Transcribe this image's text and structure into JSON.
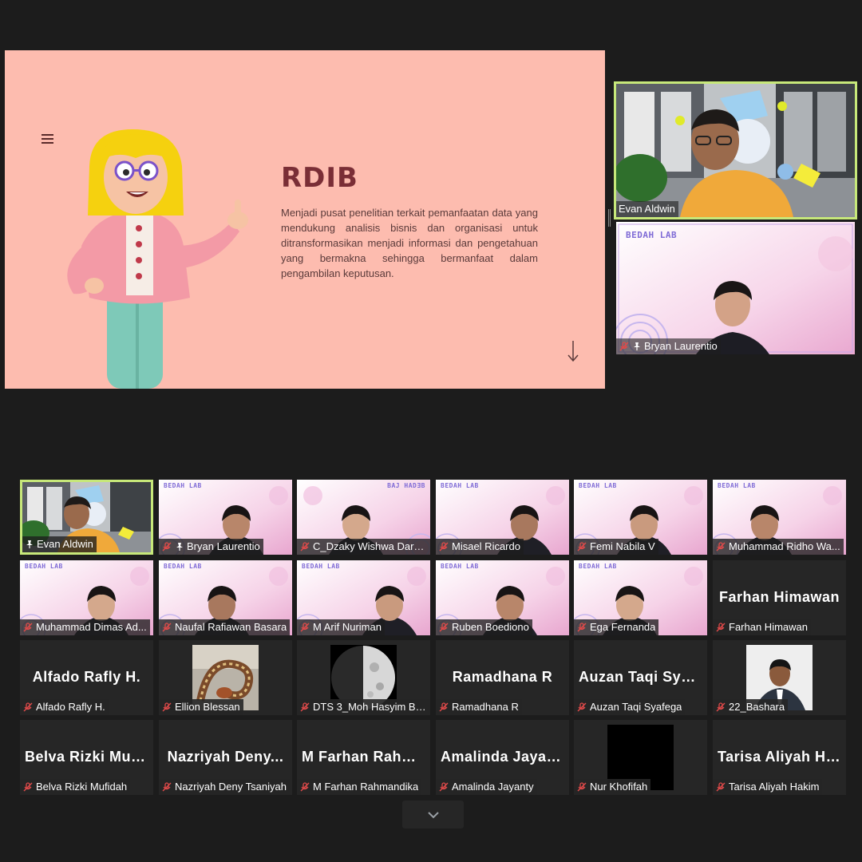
{
  "slide": {
    "title": "RDIB",
    "body": "Menjadi pusat penelitian terkait pemanfaatan data yang mendukung analisis bisnis dan organisasi untuk ditransformasikan menjadi informasi dan pengetahuan yang bermakna sehingga bermanfaat dalam pengambilan keputusan.",
    "menu_icon": "hamburger-icon",
    "arrow_icon": "arrow-down-icon",
    "colors": {
      "background": "#fdbcaf",
      "title": "#7a2e36"
    }
  },
  "pinned": {
    "speaker": {
      "name": "Evan Aldwin"
    },
    "second": {
      "name": "Bryan Laurentio",
      "brand": "BEDAH LAB"
    }
  },
  "gallery": {
    "brand": "BEDAH LAB",
    "brand_mirrored": "BAJ HADƎB",
    "tiles": [
      {
        "name": "Evan Aldwin",
        "display": ""
      },
      {
        "name": "Bryan Laurentio",
        "display": ""
      },
      {
        "name": "C_Dzaky Wishwa Darma",
        "display": ""
      },
      {
        "name": "Misael Ricardo",
        "display": ""
      },
      {
        "name": "Femi Nabila V",
        "display": ""
      },
      {
        "name": "Muhammad Ridho Wa...",
        "display": ""
      },
      {
        "name": "Muhammad Dimas Ad...",
        "display": ""
      },
      {
        "name": "Naufal Rafiawan Basara",
        "display": ""
      },
      {
        "name": "M Arif Nuriman",
        "display": ""
      },
      {
        "name": "Ruben Boediono",
        "display": ""
      },
      {
        "name": "Ega Fernanda",
        "display": ""
      },
      {
        "name": "Farhan Himawan",
        "display": "Farhan Himawan"
      },
      {
        "name": "Alfado Rafly H.",
        "display": "Alfado Rafly H."
      },
      {
        "name": "Ellion Blessan",
        "display": ""
      },
      {
        "name": "DTS 3_Moh Hasyim Bai...",
        "display": ""
      },
      {
        "name": "Ramadhana R",
        "display": "Ramadhana R"
      },
      {
        "name": "Auzan Taqi Syafega",
        "display": "Auzan Taqi Syaf..."
      },
      {
        "name": "22_Bashara",
        "display": ""
      },
      {
        "name": "Belva Rizki Mufidah",
        "display": "Belva Rizki Muf..."
      },
      {
        "name": "Nazriyah Deny Tsaniyah",
        "display": "Nazriyah Deny..."
      },
      {
        "name": "M Farhan Rahmandika",
        "display": "M Farhan Rahm..."
      },
      {
        "name": "Amalinda Jayanty",
        "display": "Amalinda Jayanty"
      },
      {
        "name": "Nur Khofifah",
        "display": ""
      },
      {
        "name": "Tarisa Aliyah Hakim",
        "display": "Tarisa Aliyah Ha..."
      }
    ]
  },
  "controls": {
    "expand_icon": "chevron-down-icon"
  }
}
